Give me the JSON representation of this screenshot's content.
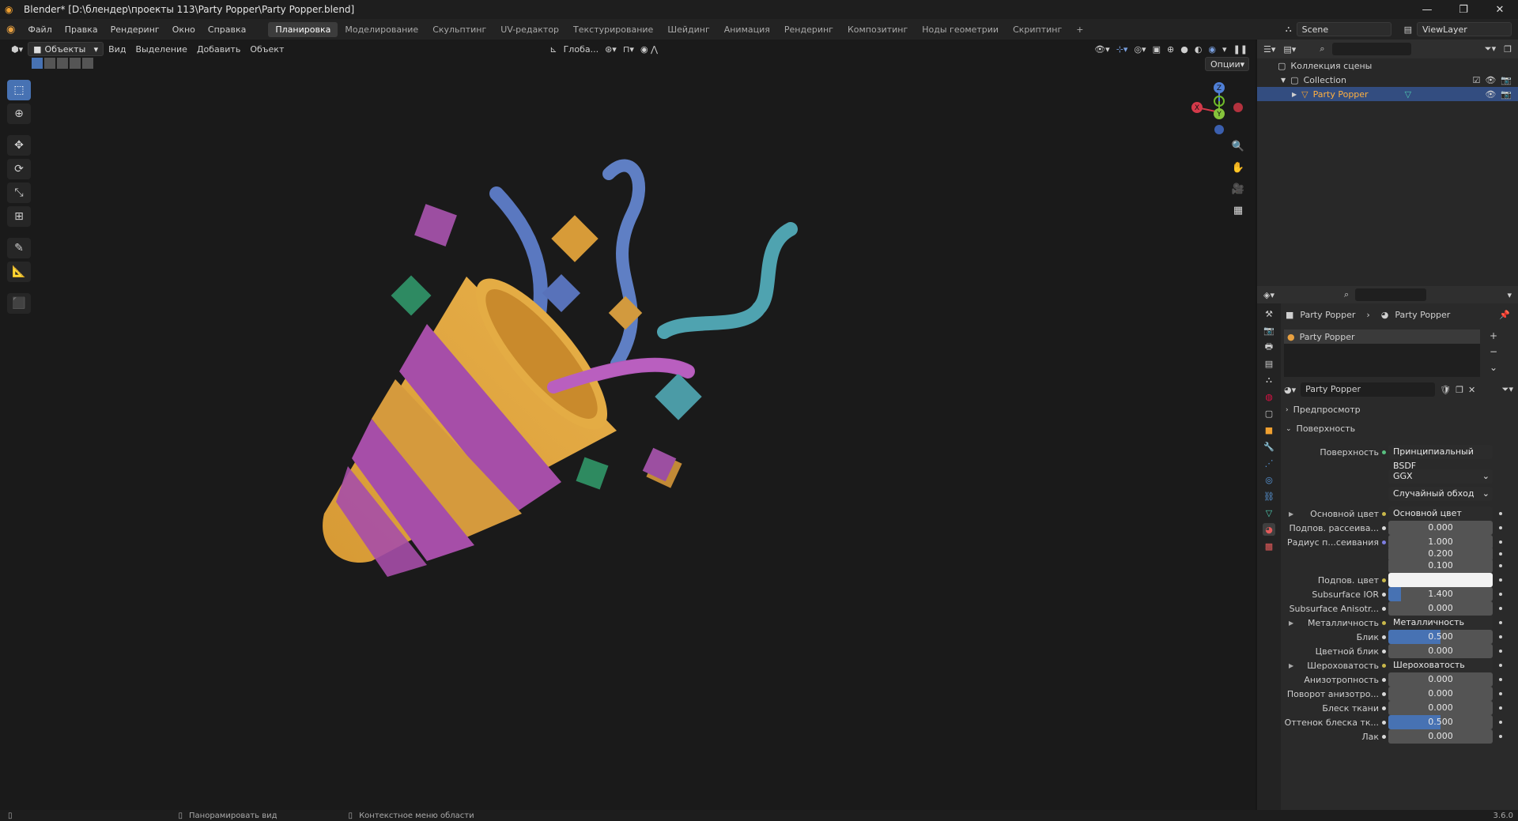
{
  "title": "Blender* [D:\\блендер\\проекты 113\\Party Popper\\Party Popper.blend]",
  "window_buttons": [
    "—",
    "❐",
    "✕"
  ],
  "menu": [
    "Файл",
    "Правка",
    "Рендеринг",
    "Окно",
    "Справка"
  ],
  "workspaces": [
    "Планировка",
    "Моделирование",
    "Скульптинг",
    "UV-редактор",
    "Текстурирование",
    "Шейдинг",
    "Анимация",
    "Рендеринг",
    "Композитинг",
    "Ноды геометрии",
    "Скриптинг",
    "+"
  ],
  "scene": "Scene",
  "view_layer": "ViewLayer",
  "viewport": {
    "mode": "Объекты",
    "menus": [
      "Вид",
      "Выделение",
      "Добавить",
      "Объект"
    ],
    "transform_orientation": "Глоба...",
    "options": "Опции",
    "gizmo": {
      "z": "Z",
      "y": "Y",
      "x": "X"
    }
  },
  "outliner": {
    "root": "Коллекция сцены",
    "collection": "Collection",
    "object": "Party Popper"
  },
  "properties": {
    "breadcrumb": [
      "Party Popper",
      "Party Popper"
    ],
    "slot": "Party Popper",
    "material_name": "Party Popper",
    "preview": "Предпросмотр",
    "surface_panel": "Поверхность",
    "surface_label": "Поверхность",
    "surface_value": "Принципиальный BSDF",
    "distribution": "GGX",
    "subsurface_method": "Случайный обход",
    "rows": [
      {
        "label": "Основной цвет",
        "value": "Основной цвет",
        "kind": "link",
        "expand": true
      },
      {
        "label": "Подпов. рассеива...",
        "value": "0.000",
        "kind": "num"
      },
      {
        "label": "Радиус п...сеивания",
        "value": "1.000",
        "kind": "num",
        "dotcolor": "p"
      },
      {
        "label": "",
        "value": "0.200",
        "kind": "num",
        "nodot": true
      },
      {
        "label": "",
        "value": "0.100",
        "kind": "num",
        "nodot": true
      },
      {
        "label": "Подпов. цвет",
        "value": "",
        "kind": "white",
        "dotcolor": "y"
      },
      {
        "label": "Subsurface IOR",
        "value": "1.400",
        "kind": "ior"
      },
      {
        "label": "Subsurface Anisotr...",
        "value": "0.000",
        "kind": "num"
      },
      {
        "label": "Металличность",
        "value": "Металличность",
        "kind": "link",
        "expand": true
      },
      {
        "label": "Блик",
        "value": "0.500",
        "kind": "blue"
      },
      {
        "label": "Цветной блик",
        "value": "0.000",
        "kind": "num"
      },
      {
        "label": "Шероховатость",
        "value": "Шероховатость",
        "kind": "link",
        "expand": true
      },
      {
        "label": "Анизотропность",
        "value": "0.000",
        "kind": "num"
      },
      {
        "label": "Поворот анизотро...",
        "value": "0.000",
        "kind": "num"
      },
      {
        "label": "Блеск ткани",
        "value": "0.000",
        "kind": "num"
      },
      {
        "label": "Оттенок блеска тк...",
        "value": "0.500",
        "kind": "blue"
      },
      {
        "label": "Лак",
        "value": "0.000",
        "kind": "num"
      }
    ]
  },
  "status": {
    "pan": "Панорамировать вид",
    "context_menu": "Контекстное меню области",
    "version": "3.6.0"
  }
}
